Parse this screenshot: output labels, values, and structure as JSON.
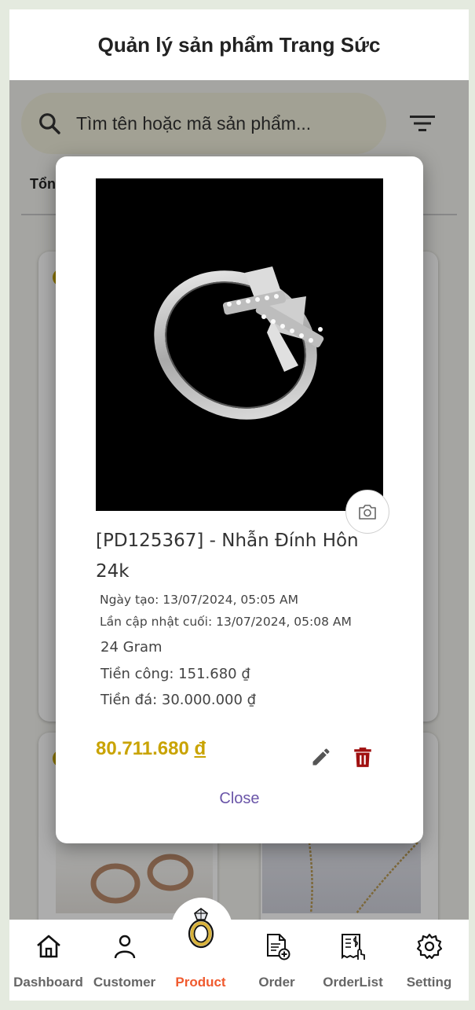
{
  "header": {
    "title": "Quản lý sản phẩm Trang Sức"
  },
  "search": {
    "placeholder": "Tìm tên hoặc mã sản phẩm..."
  },
  "list": {
    "total_label": "Tổn"
  },
  "modal": {
    "title": "[PD125367] - Nhẫn Đính Hôn 24k",
    "created": "Ngày tạo: 13/07/2024, 05:05 AM",
    "updated": "Lần cập nhật cuối: 13/07/2024, 05:08 AM",
    "weight": "24 Gram",
    "labor_cost": "Tiền công: 151.680 ₫",
    "stone_cost": "Tiền đá: 30.000.000 ₫",
    "price_value": "80.711.680",
    "price_currency": "đ",
    "close_label": "Close"
  },
  "nav": {
    "items": [
      {
        "label": "Dashboard",
        "icon": "home-icon"
      },
      {
        "label": "Customer",
        "icon": "person-icon"
      },
      {
        "label": "Product",
        "icon": "ring-icon",
        "active": true
      },
      {
        "label": "Order",
        "icon": "add-document-icon"
      },
      {
        "label": "OrderList",
        "icon": "receipt-icon"
      },
      {
        "label": "Setting",
        "icon": "gear-icon"
      }
    ]
  },
  "colors": {
    "accent_price": "#c9a300",
    "active_nav": "#f05a2e",
    "delete": "#a01010",
    "close_text": "#6a55a8"
  }
}
